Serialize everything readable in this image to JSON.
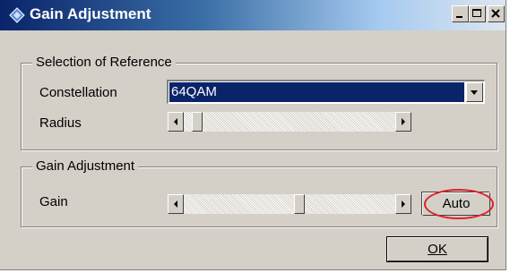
{
  "window": {
    "title": "Gain Adjustment",
    "icons": {
      "app": "diamond-app-icon",
      "minimize": "minimize-icon",
      "maximize": "maximize-icon",
      "close": "close-icon"
    }
  },
  "reference_group": {
    "title": "Selection of Reference",
    "constellation_label": "Constellation",
    "constellation_value": "64QAM",
    "radius_label": "Radius",
    "radius_slider_position": 0.04
  },
  "gain_group": {
    "title": "Gain Adjustment",
    "gain_label": "Gain",
    "gain_slider_position": 0.55,
    "auto_label": "Auto"
  },
  "ok_label": "OK",
  "colors": {
    "selection": "#0a246a",
    "highlight_circle": "#e0202a",
    "face": "#d4d0c8"
  }
}
